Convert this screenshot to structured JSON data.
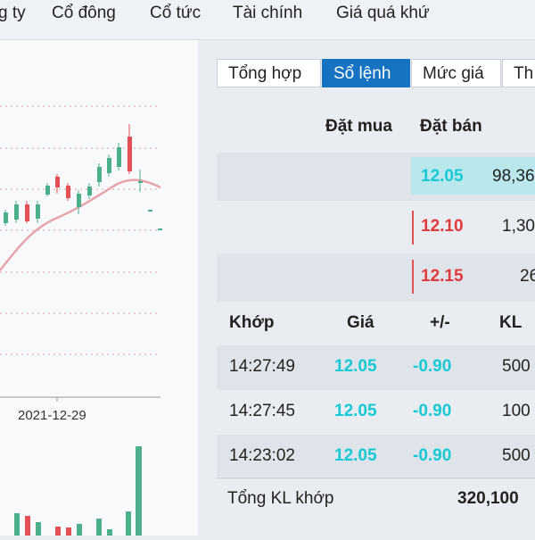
{
  "topnav": {
    "items": [
      "g ty",
      "Cổ đông",
      "Cổ tức",
      "Tài chính",
      "Giá quá khứ"
    ]
  },
  "chart": {
    "date_label": "2021-12-29",
    "colors": {
      "up": "#4caf8c",
      "down": "#e44f56",
      "ma": "#e8a3a8"
    }
  },
  "tabs": [
    "Tổng hợp",
    "Sổ lệnh",
    "Mức giá",
    "Th"
  ],
  "orderbook": {
    "head_buy": "Đặt mua",
    "head_sell": "Đặt bán",
    "rows": [
      {
        "price": "12.05",
        "vol": "98,36",
        "color": "#17c9d4"
      },
      {
        "price": "12.10",
        "vol": "1,30",
        "color": "#e03a3a"
      },
      {
        "price": "12.15",
        "vol": "26",
        "color": "#e03a3a"
      }
    ]
  },
  "matched": {
    "headers": {
      "time": "Khớp",
      "price": "Giá",
      "change": "+/-",
      "kl": "KL"
    },
    "rows": [
      {
        "time": "14:27:49",
        "price": "12.05",
        "change": "-0.90",
        "kl": "500"
      },
      {
        "time": "14:27:45",
        "price": "12.05",
        "change": "-0.90",
        "kl": "100"
      },
      {
        "time": "14:23:02",
        "price": "12.05",
        "change": "-0.90",
        "kl": "500"
      }
    ],
    "total_label": "Tổng KL khớp",
    "total_value": "320,100"
  }
}
